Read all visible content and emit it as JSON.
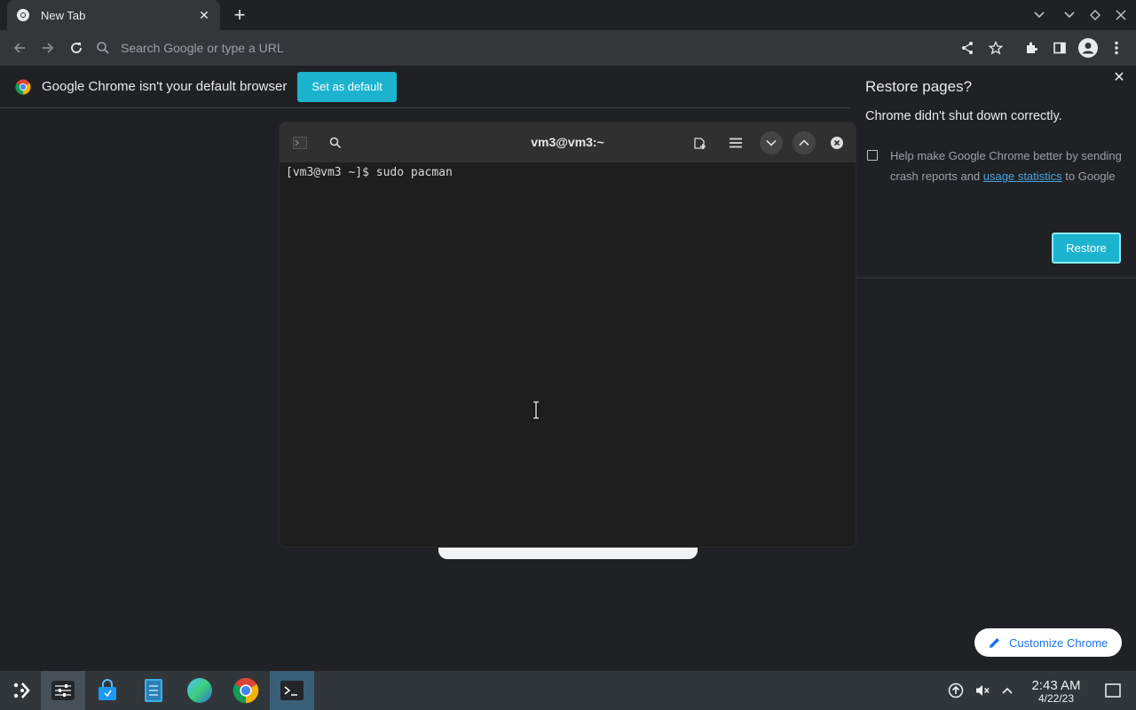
{
  "browser": {
    "tab": {
      "title": "New Tab"
    },
    "omnibox": {
      "placeholder": "Search Google or type a URL"
    },
    "infobar": {
      "message": "Google Chrome isn't your default browser",
      "button": "Set as default"
    },
    "restore_bubble": {
      "title": "Restore pages?",
      "subtitle": "Chrome didn't shut down correctly.",
      "help_text_before": "Help make Google Chrome better by sending crash reports and ",
      "help_link": "usage statistics",
      "help_text_after": " to Google",
      "restore_button": "Restore"
    },
    "customize_button": "Customize Chrome"
  },
  "terminal": {
    "title": "vm3@vm3:~",
    "prompt_line": "[vm3@vm3 ~]$ sudo pacman"
  },
  "taskbar": {
    "time": "2:43 AM",
    "date": "4/22/23"
  },
  "colors": {
    "accent": "#1cb3cf",
    "link": "#4aa3e0",
    "chrome_bg": "#202124",
    "toolbar_bg": "#35363a",
    "taskbar_bg": "#31363b"
  }
}
